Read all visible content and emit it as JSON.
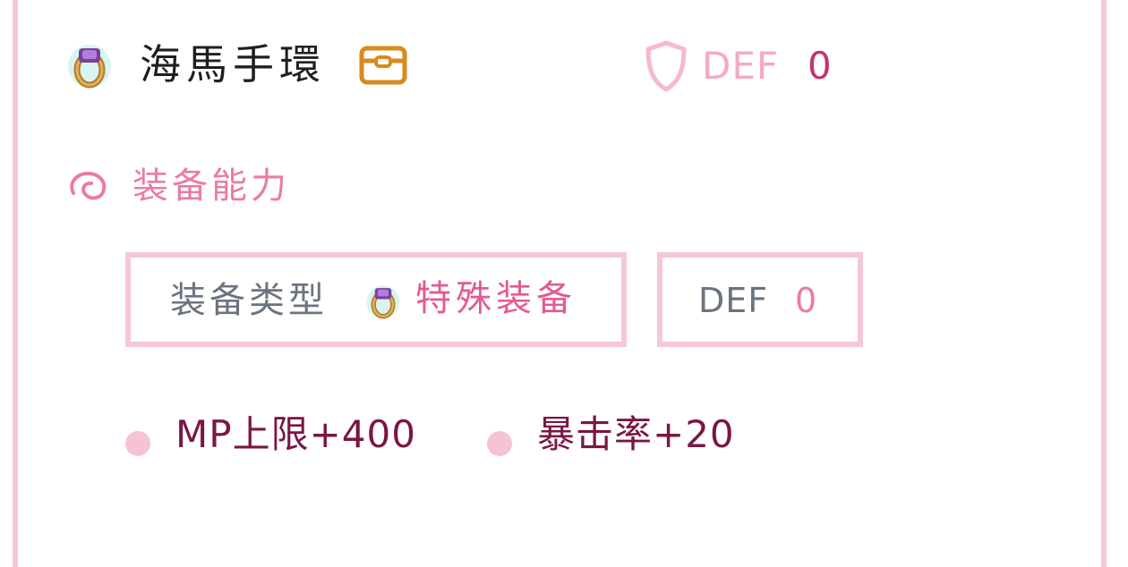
{
  "item": {
    "name": "海馬手環",
    "icon": "ring-icon",
    "stat": {
      "label": "DEF",
      "value": "0"
    }
  },
  "section": {
    "title": "装备能力",
    "icon": "spiral-icon"
  },
  "equip": {
    "type_label": "装备类型",
    "type_value": "特殊装备",
    "def_label": "DEF",
    "def_value": "0"
  },
  "bonuses": [
    "MP上限+400",
    "暴击率+20"
  ],
  "colors": {
    "border": "#f7c7d9",
    "pink_accent": "#ec7aa6",
    "dark_value": "#7a1645",
    "bag_orange": "#d88a1e"
  }
}
